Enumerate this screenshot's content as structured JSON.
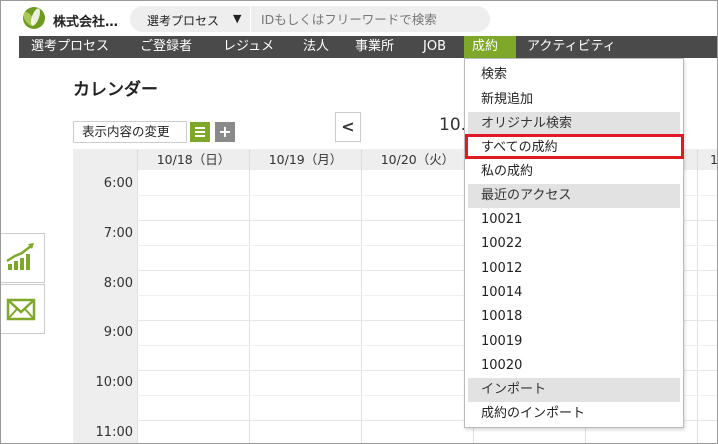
{
  "header": {
    "company": "株式会社…",
    "process_select": "選考プロセス",
    "search_placeholder": "IDもしくはフリーワードで検索"
  },
  "nav": {
    "items": [
      "選考プロセス",
      "ご登録者",
      "レジュメ",
      "法人",
      "事業所",
      "JOB",
      "成約",
      "アクティビティ"
    ],
    "active": "成約"
  },
  "page": {
    "title": "カレンダー",
    "view_change_label": "表示内容の変更",
    "add_label": "+",
    "prev_label": "<",
    "month_title": "10."
  },
  "calendar": {
    "days": [
      "10/18（日）",
      "10/19（月）",
      "10/20（火）"
    ],
    "days_right_partial": "1",
    "times": [
      "6:00",
      "7:00",
      "8:00",
      "9:00",
      "10:00",
      "11:00"
    ]
  },
  "dropdown": {
    "items": [
      {
        "label": "検索",
        "type": "item"
      },
      {
        "label": "新規追加",
        "type": "item"
      },
      {
        "label": "オリジナル検索",
        "type": "section"
      },
      {
        "label": "すべての成約",
        "type": "item",
        "highlighted": true
      },
      {
        "label": "私の成約",
        "type": "item"
      },
      {
        "label": "最近のアクセス",
        "type": "section"
      },
      {
        "label": "10021",
        "type": "item"
      },
      {
        "label": "10022",
        "type": "item"
      },
      {
        "label": "10012",
        "type": "item"
      },
      {
        "label": "10014",
        "type": "item"
      },
      {
        "label": "10018",
        "type": "item"
      },
      {
        "label": "10019",
        "type": "item"
      },
      {
        "label": "10020",
        "type": "item"
      },
      {
        "label": "インポート",
        "type": "section"
      },
      {
        "label": "成約のインポート",
        "type": "item"
      }
    ]
  },
  "colors": {
    "accent": "#7fa82a",
    "nav_bg": "#4a4a4a",
    "highlight": "#e01a22",
    "section_bg": "#e2e2e2"
  },
  "icons": {
    "logo": "company-logo",
    "side_chart": "chart-icon",
    "side_mail": "mail-icon",
    "list": "list-icon",
    "caret": "caret-down-icon"
  }
}
